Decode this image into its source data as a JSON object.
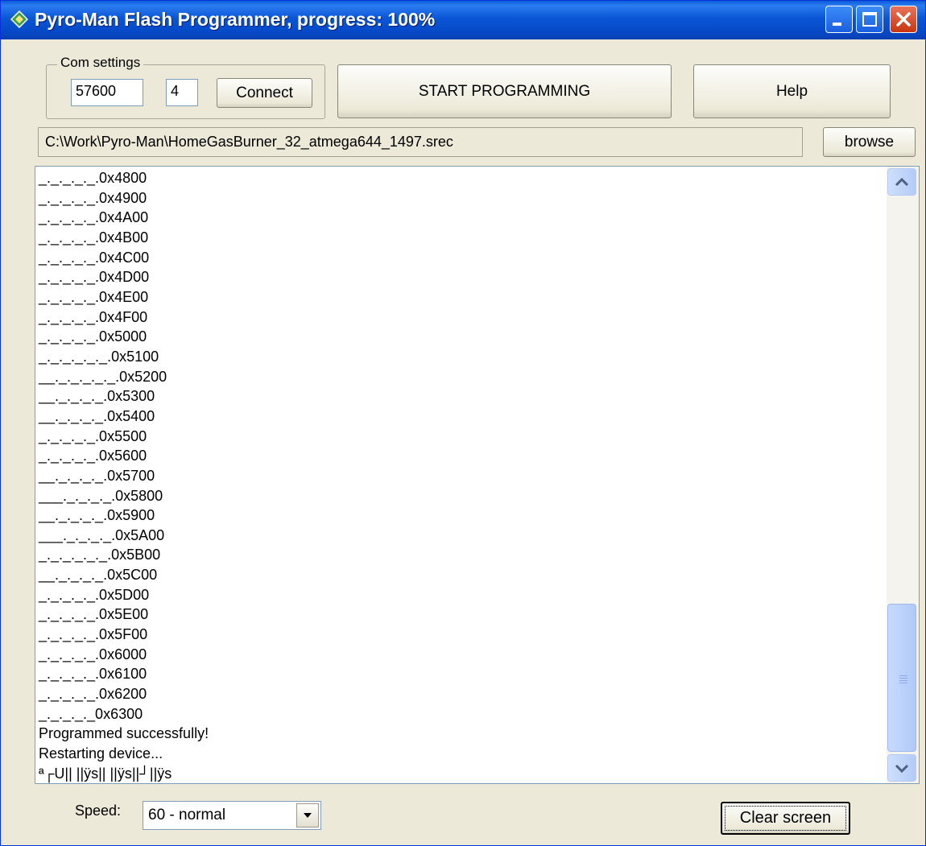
{
  "window": {
    "title": "Pyro-Man Flash Programmer, progress: 100%",
    "titlebar_color": "#0a56d6",
    "icon": "diamond-app-icon",
    "controls": [
      "minimize-icon",
      "maximize-icon",
      "close-icon"
    ]
  },
  "com_settings": {
    "group_label": "Com settings",
    "baud_rate": "57600",
    "port": "4",
    "connect_label": "Connect"
  },
  "actions": {
    "start_label": "START PROGRAMMING",
    "help_label": "Help",
    "browse_label": "browse"
  },
  "file_path": "C:\\Work\\Pyro-Man\\HomeGasBurner_32_atmega644_1497.srec",
  "log": {
    "lines": [
      "_._._._._.0x4800",
      "_._._._._.0x4900",
      "_._._._._.0x4A00",
      "_._._._._.0x4B00",
      "_._._._._.0x4C00",
      "_._._._._.0x4D00",
      "_._._._._.0x4E00",
      "_._._._._.0x4F00",
      "_._._._._.0x5000",
      "_._._._._._.0x5100",
      "__._._._._._.0x5200",
      "__._._._._.0x5300",
      "__._._._._.0x5400",
      "_._._._._.0x5500",
      "_._._._._.0x5600",
      "__._._._._.0x5700",
      "___._._._._.0x5800",
      "__._._._._.0x5900",
      "___._._._._.0x5A00",
      "_._._._._._.0x5B00",
      "__._._._._.0x5C00",
      "_._._._._.0x5D00",
      "_._._._._.0x5E00",
      "_._._._._.0x5F00",
      "_._._._._.0x6000",
      "_._._._._.0x6100",
      "_._._._._.0x6200",
      "_._._._._0x6300",
      "Programmed successfully!",
      "Restarting device...",
      "ª┌U|| ||ÿs|| ||ÿs||┘||ÿs"
    ],
    "scroll_position": 0.95
  },
  "speed": {
    "label": "Speed:",
    "selected": "60  - normal"
  },
  "clear_label": "Clear screen"
}
